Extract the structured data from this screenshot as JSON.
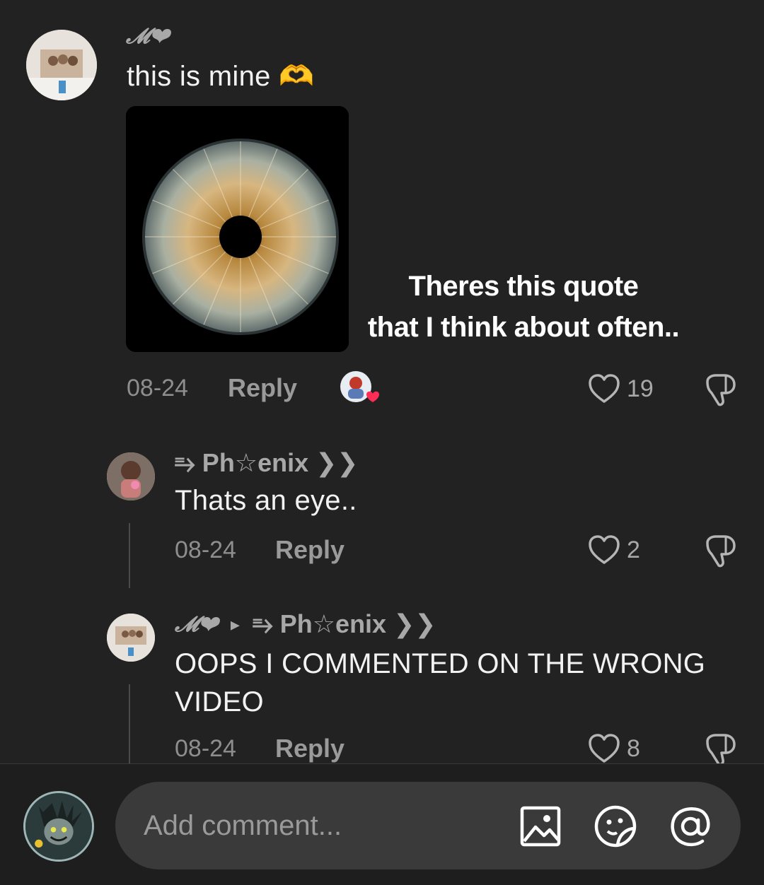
{
  "comments": [
    {
      "username": "𝓜❤",
      "text": "this is mine 🫶",
      "quote_line1": "Theres this quote",
      "quote_line2": "that I think about often..",
      "date": "08-24",
      "reply_label": "Reply",
      "likes": "19"
    },
    {
      "username": "⥱ Ph☆enix ❯❯",
      "text": "Thats an eye..",
      "date": "08-24",
      "reply_label": "Reply",
      "likes": "2"
    },
    {
      "username": "𝓜❤",
      "reply_arrow": "▸",
      "reply_to": "⥱ Ph☆enix ❯❯",
      "text_line1": "OOPS I COMMENTED ON THE WRONG",
      "text_line2": "VIDEO",
      "date": "08-24",
      "reply_label": "Reply",
      "likes": "8"
    }
  ],
  "composer": {
    "placeholder": "Add comment..."
  },
  "colors": {
    "background": "#222222",
    "like_heart_creator": "#ff2d55"
  }
}
